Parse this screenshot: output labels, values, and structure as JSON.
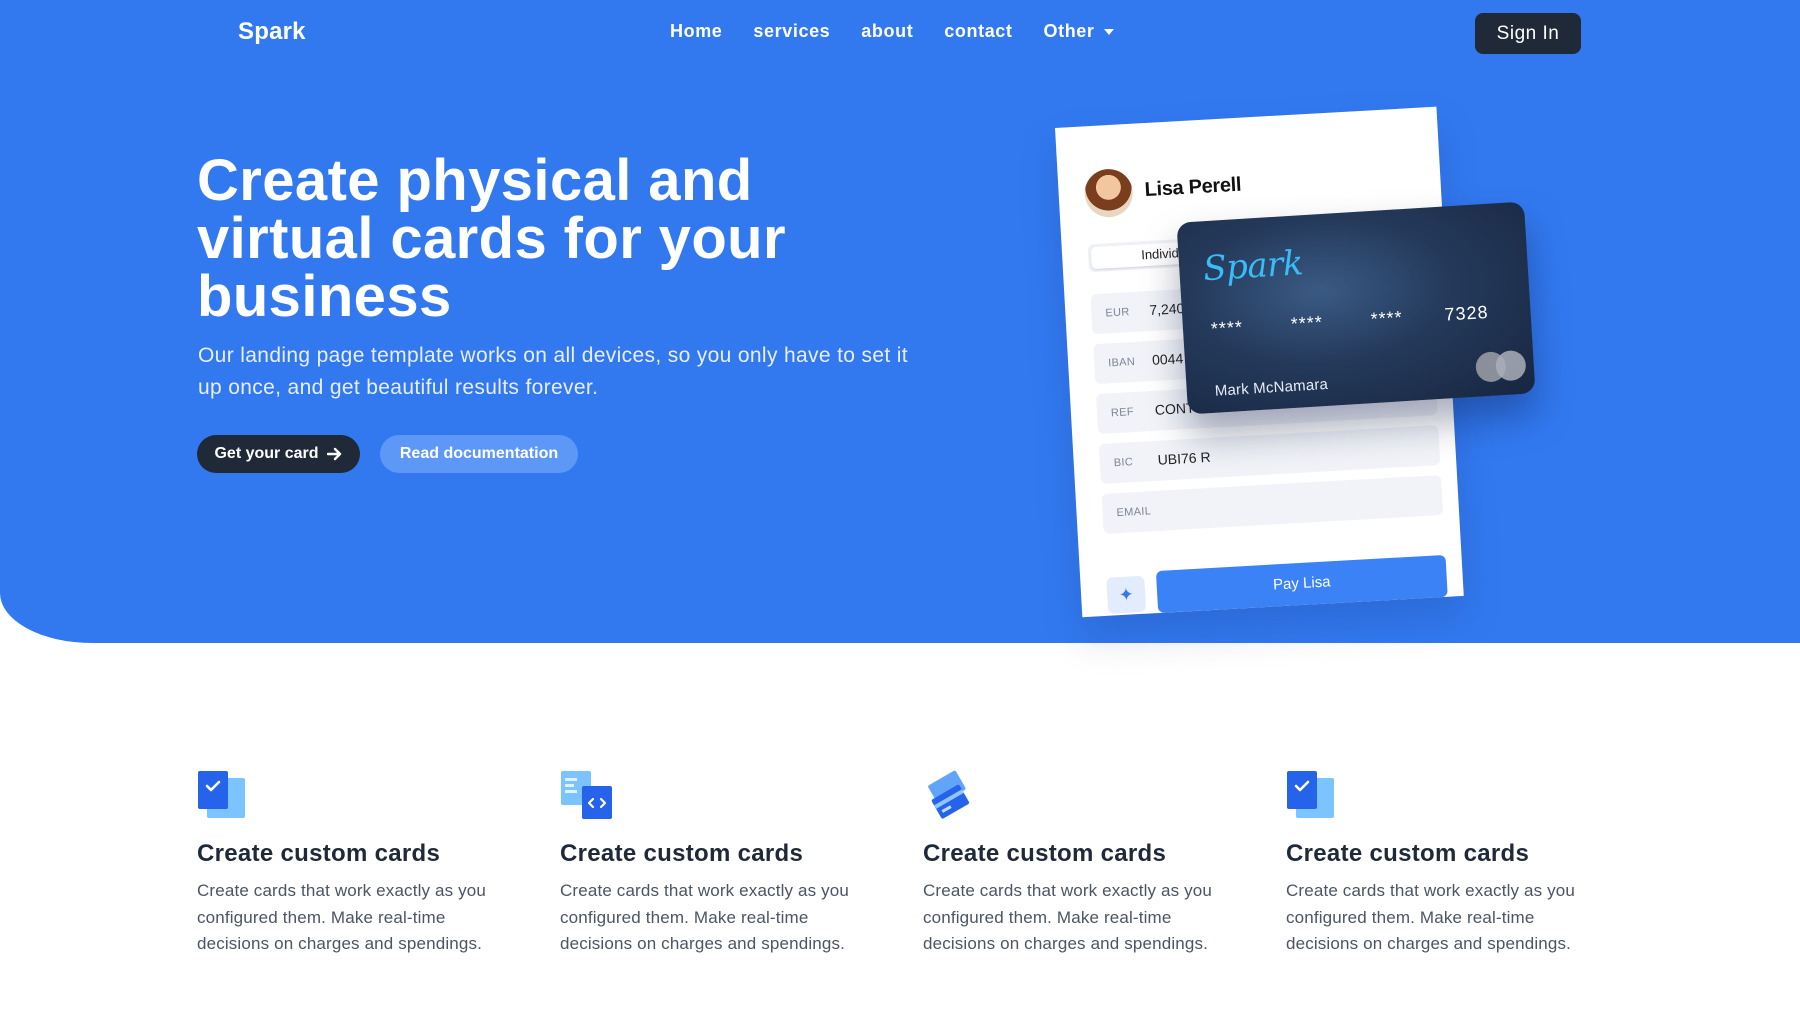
{
  "nav": {
    "brand": "Spark",
    "links": [
      {
        "label": "Home"
      },
      {
        "label": "services"
      },
      {
        "label": "about"
      },
      {
        "label": "contact"
      },
      {
        "label": "Other"
      }
    ],
    "signin_label": "Sign In"
  },
  "hero": {
    "title": "Create physical and virtual cards for your business",
    "subtitle": "Our landing page template works on all devices, so you only have to set it up once, and get beautiful results forever.",
    "primary_cta": "Get your card",
    "secondary_cta": "Read documentation"
  },
  "mockup": {
    "form": {
      "name": "Lisa Perell",
      "segment": "Individ",
      "fields": [
        {
          "label": "EUR",
          "value": "7,240"
        },
        {
          "label": "IBAN",
          "value": "0044"
        },
        {
          "label": "REF",
          "value": "CONT"
        },
        {
          "label": "BIC",
          "value": "UBI76 R"
        },
        {
          "label": "EMAIL",
          "value": ""
        }
      ],
      "pay_label": "Pay Lisa"
    },
    "card": {
      "brand": "Spark",
      "number_groups": [
        "****",
        "****",
        "****",
        "7328"
      ],
      "holder": "Mark McNamara"
    }
  },
  "features": [
    {
      "icon": "checklist-icon",
      "title": "Create custom cards",
      "text": "Create cards that work exactly as you configured them. Make real-time decisions on charges and spendings."
    },
    {
      "icon": "code-document-icon",
      "title": "Create custom cards",
      "text": "Create cards that work exactly as you configured them. Make real-time decisions on charges and spendings."
    },
    {
      "icon": "credit-cards-icon",
      "title": "Create custom cards",
      "text": "Create cards that work exactly as you configured them. Make real-time decisions on charges and spendings."
    },
    {
      "icon": "checklist-icon",
      "title": "Create custom cards",
      "text": "Create cards that work exactly as you configured them. Make real-time decisions on charges and spendings."
    }
  ],
  "colors": {
    "primary": "#3279F0",
    "dark": "#1F2937",
    "accent_light": "#5D98F7",
    "card_brand": "#38BDF8"
  }
}
